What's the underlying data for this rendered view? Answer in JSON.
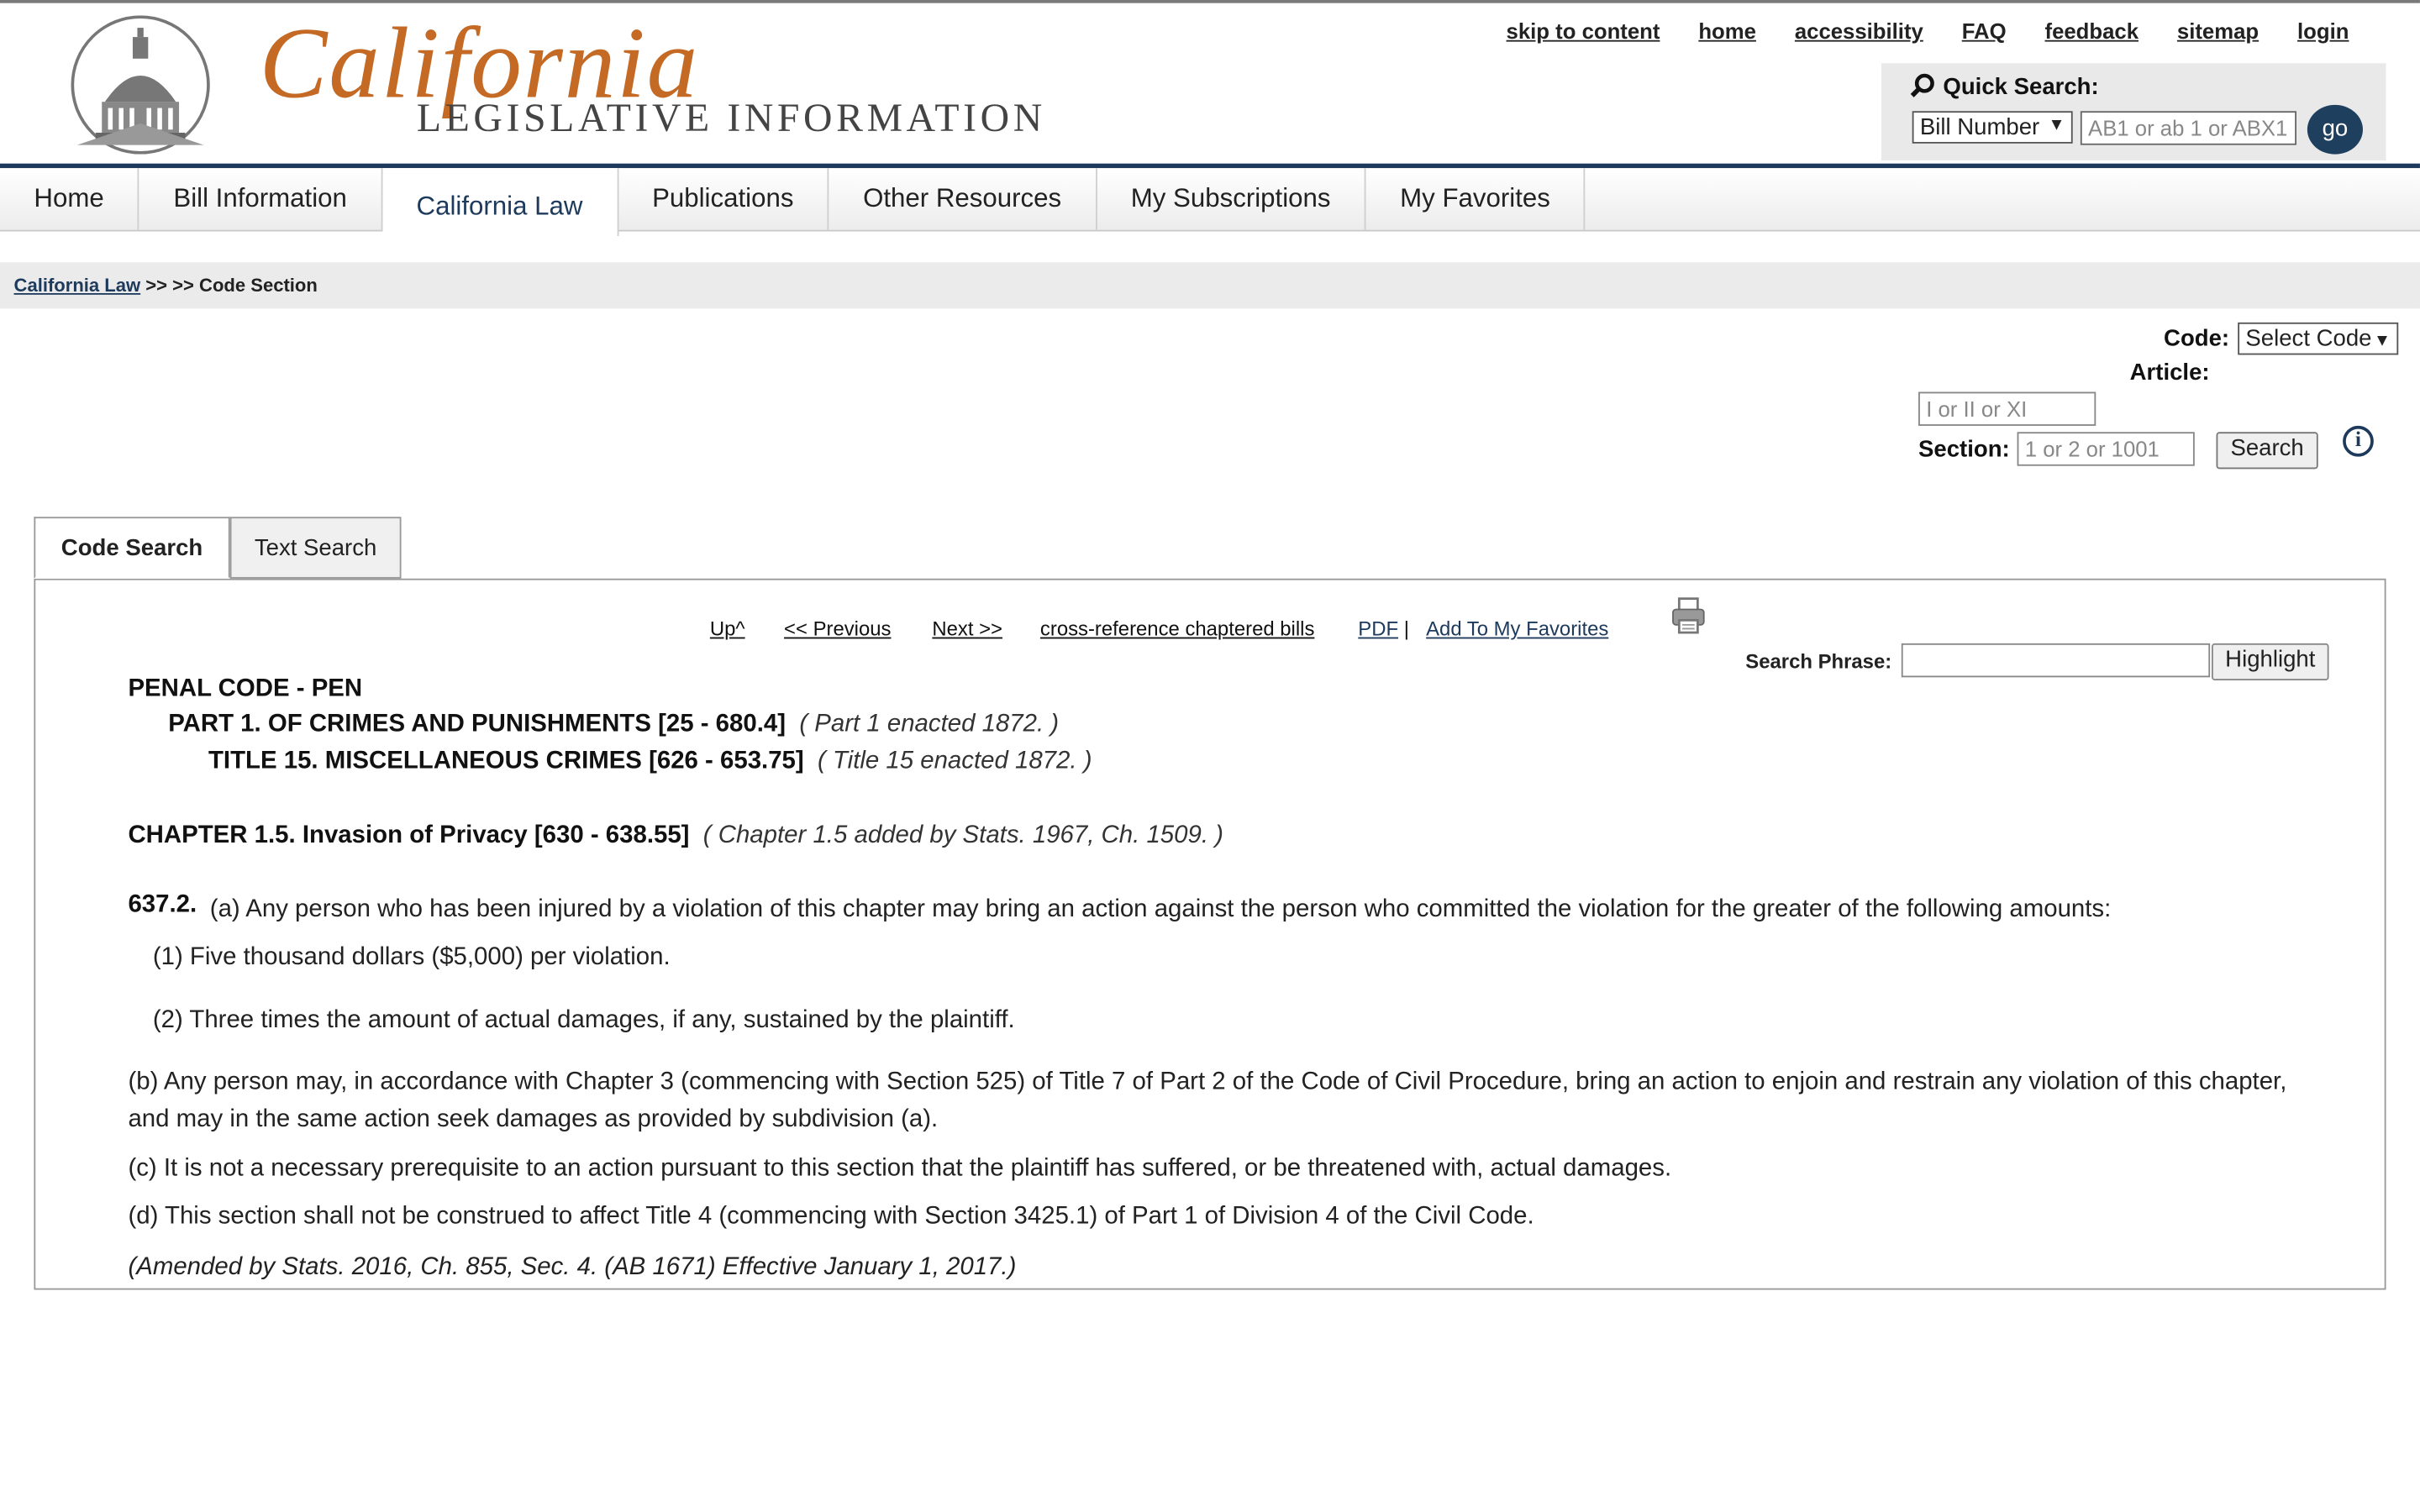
{
  "header": {
    "logo_script": "California",
    "logo_sub": "LEGISLATIVE INFORMATION",
    "top_links": [
      "skip to content",
      "home",
      "accessibility",
      "FAQ",
      "feedback",
      "sitemap",
      "login"
    ],
    "quick_search": {
      "title": "Quick Search:",
      "select_value": "Bill Number",
      "input_placeholder": "AB1 or ab 1 or ABX1",
      "go_label": "go"
    }
  },
  "nav": {
    "items": [
      "Home",
      "Bill Information",
      "California Law",
      "Publications",
      "Other Resources",
      "My Subscriptions",
      "My Favorites"
    ],
    "active": "California Law"
  },
  "breadcrumb": {
    "link": "California Law",
    "rest": " >> >> Code Section"
  },
  "code_form": {
    "code_label": "Code:",
    "code_select": "Select Code",
    "article_label": "Article:",
    "article_placeholder": "I or II or XI",
    "section_label": "Section:",
    "section_placeholder": "1 or 2 or 1001",
    "search_button": "Search"
  },
  "tabs": [
    "Code Search",
    "Text Search"
  ],
  "toolbar": {
    "up": "Up^",
    "previous": "<< Previous",
    "next": "Next >>",
    "cross_reference": "cross-reference chaptered bills",
    "pdf": "PDF",
    "sep": "|",
    "favorites": "Add To My Favorites",
    "search_phrase_label": "Search Phrase:",
    "highlight_button": "Highlight"
  },
  "law": {
    "code": "PENAL CODE - PEN",
    "part": "PART 1. OF CRIMES AND PUNISHMENTS [25 - 680.4]",
    "part_note": "( Part 1 enacted 1872. )",
    "title": "TITLE 15. MISCELLANEOUS CRIMES [626 - 653.75]",
    "title_note": "( Title 15 enacted 1872. )",
    "chapter": "CHAPTER 1.5. Invasion of Privacy [630 - 638.55]",
    "chapter_note": "( Chapter 1.5 added by Stats. 1967, Ch. 1509. )",
    "section_num": "637.2.",
    "para_a": "(a) Any person who has been injured by a violation of this chapter may bring an action against the person who committed the violation for the greater of the following amounts:",
    "para_a1": "(1) Five thousand dollars ($5,000) per violation.",
    "para_a2": "(2) Three times the amount of actual damages, if any, sustained by the plaintiff.",
    "para_b1": "(b) Any person may, in accordance with Chapter 3 (commencing with Section 525) of Title 7 of Part 2 of the Code of Civil Procedure, bring an action to enjoin and restrain any violation of this chapter,",
    "para_b2": "and may in the same action seek damages as provided by subdivision (a).",
    "para_c": "(c) It is not a necessary prerequisite to an action pursuant to this section that the plaintiff has suffered, or be threatened with, actual damages.",
    "para_d": "(d) This section shall not be construed to affect Title 4 (commencing with Section 3425.1) of Part 1 of Division 4 of the Civil Code.",
    "history": "(Amended by Stats. 2016, Ch. 855, Sec. 4. (AB 1671) Effective January 1, 2017.)"
  }
}
